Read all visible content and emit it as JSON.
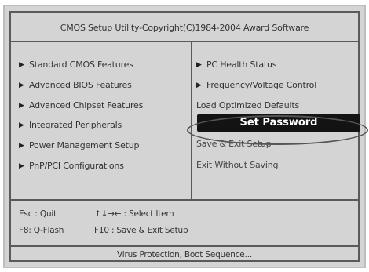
{
  "title": "CMOS Setup Utility-Copyright(C)1984-2004 Award Software",
  "left_menu": [
    {
      "label": "Standard CMOS Features"
    },
    {
      "label": "Advanced BIOS Features"
    },
    {
      "label": "Advanced Chipset Features"
    },
    {
      "label": "Integrated Peripherals"
    },
    {
      "label": "Power Management Setup"
    },
    {
      "label": "PnP/PCI Configurations"
    }
  ],
  "right_menu": [
    {
      "label": "PC Health Status"
    },
    {
      "label": "Frequency/Voltage Control"
    },
    {
      "label": "Load Optimized Defaults"
    },
    {
      "label": "Set Password"
    },
    {
      "label": "Save & Exit Setup"
    },
    {
      "label": "Exit Without Saving"
    }
  ],
  "help": {
    "esc_key": "Esc : Quit",
    "arrows": "↑↓→← : Select Item",
    "f8_key": "F8: Q-Flash",
    "f10_key": "F10 : Save & Exit Setup"
  },
  "footer": "Virus Protection, Boot Sequence..."
}
